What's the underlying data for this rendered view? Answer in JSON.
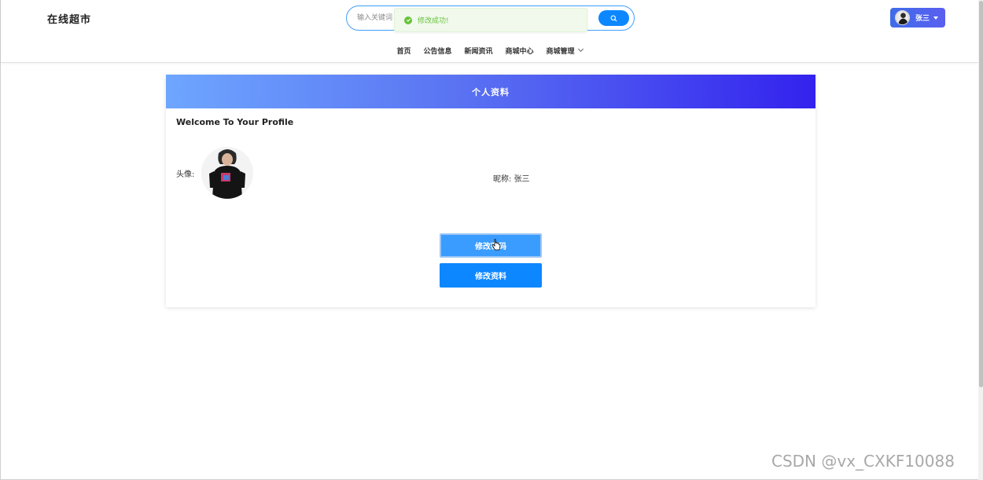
{
  "header": {
    "logo": "在线超市",
    "search": {
      "placeholder": "输入关键词"
    },
    "user": {
      "name": "张三"
    }
  },
  "toast": {
    "message": "修改成功!",
    "type": "success"
  },
  "nav": {
    "items": [
      {
        "label": "首页"
      },
      {
        "label": "公告信息"
      },
      {
        "label": "新闻资讯"
      },
      {
        "label": "商城中心"
      },
      {
        "label": "商城管理",
        "has_dropdown": true
      }
    ]
  },
  "profile": {
    "title": "个人资料",
    "welcome": "Welcome To Your Profile",
    "avatar_label": "头像:",
    "nickname_label": "昵称:",
    "nickname": "张三",
    "buttons": {
      "change_password": "修改密码",
      "edit_profile": "修改资料"
    }
  },
  "watermark": "CSDN @vx_CXKF10088",
  "colors": {
    "primary": "#0d87ff",
    "success": "#67c23a",
    "header_gradient_start": "#6ea6ff",
    "header_gradient_end": "#3322ee"
  }
}
